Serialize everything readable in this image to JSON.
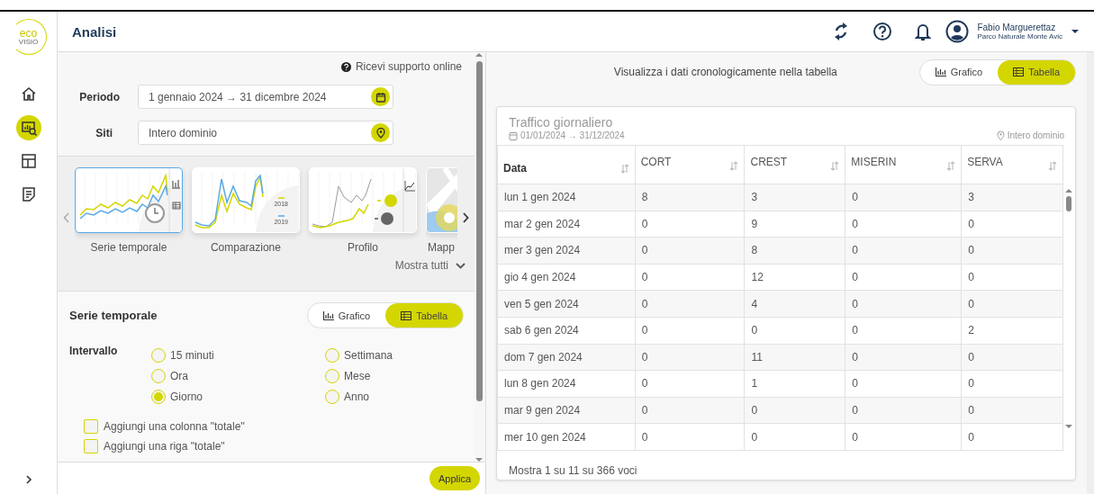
{
  "logo": {
    "top": "eco",
    "bottom": "VISIO"
  },
  "nav": [
    {
      "kind": "home",
      "selected": false
    },
    {
      "kind": "analysis",
      "selected": true
    },
    {
      "kind": "dashboard",
      "selected": false
    },
    {
      "kind": "report",
      "selected": false
    }
  ],
  "header": {
    "title": "Analisi",
    "user": {
      "name": "Fabio Marguerettaz",
      "org": "Parco Naturale Monte Avic"
    }
  },
  "filters": {
    "support": "Ricevi supporto online",
    "period": {
      "label": "Periodo",
      "value": "1 gennaio 2024 → 31 dicembre 2024"
    },
    "sites": {
      "label": "Siti",
      "value": "Intero dominio"
    }
  },
  "carousel": {
    "items": [
      {
        "kind": "timeseries",
        "label": "Serie temporale",
        "selected": true
      },
      {
        "kind": "comparison",
        "label": "Comparazione",
        "selected": false,
        "legend": [
          "2018",
          "2019"
        ]
      },
      {
        "kind": "profile",
        "label": "Profilo",
        "selected": false
      },
      {
        "kind": "map",
        "label": "Mapp",
        "selected": false
      }
    ],
    "show_all": "Mostra tutti"
  },
  "settings": {
    "title": "Serie temporale",
    "view": [
      {
        "kind": "chart",
        "label": "Grafico",
        "selected": false
      },
      {
        "kind": "table",
        "label": "Tabella",
        "selected": true
      }
    ],
    "interval_label": "Intervallo",
    "intervals": [
      {
        "label": "15 minuti",
        "selected": false
      },
      {
        "label": "Ora",
        "selected": false
      },
      {
        "label": "Giorno",
        "selected": true
      },
      {
        "label": "Settimana",
        "selected": false
      },
      {
        "label": "Mese",
        "selected": false
      },
      {
        "label": "Anno",
        "selected": false
      }
    ],
    "options": [
      {
        "label": "Aggiungi una colonna \"totale\"",
        "checked": false
      },
      {
        "label": "Aggiungi una riga \"totale\"",
        "checked": false
      }
    ],
    "apply": "Applica"
  },
  "result": {
    "caption": "Visualizza i dati cronologicamente nella tabella",
    "view": [
      {
        "kind": "chart",
        "label": "Grafico",
        "selected": false
      },
      {
        "kind": "table",
        "label": "Tabella",
        "selected": true
      }
    ],
    "card": {
      "title": "Traffico giornaliero",
      "dates": "01/01/2024 → 31/12/2024",
      "site": "Intero dominio",
      "columns": [
        "Data",
        "CORT",
        "CREST",
        "MISERIN",
        "SERVA"
      ],
      "rows": [
        [
          "lun 1 gen 2024",
          "8",
          "3",
          "0",
          "3"
        ],
        [
          "mar 2 gen 2024",
          "0",
          "9",
          "0",
          "0"
        ],
        [
          "mer 3 gen 2024",
          "0",
          "8",
          "0",
          "0"
        ],
        [
          "gio 4 gen 2024",
          "0",
          "12",
          "0",
          "0"
        ],
        [
          "ven 5 gen 2024",
          "0",
          "4",
          "0",
          "0"
        ],
        [
          "sab 6 gen 2024",
          "0",
          "0",
          "0",
          "2"
        ],
        [
          "dom 7 gen 2024",
          "0",
          "11",
          "0",
          "0"
        ],
        [
          "lun 8 gen 2024",
          "0",
          "1",
          "0",
          "0"
        ],
        [
          "mar 9 gen 2024",
          "0",
          "0",
          "0",
          "0"
        ],
        [
          "mer 10 gen 2024",
          "0",
          "0",
          "0",
          "0"
        ]
      ],
      "footer": "Mostra 1 su 11 su 366 voci"
    }
  }
}
